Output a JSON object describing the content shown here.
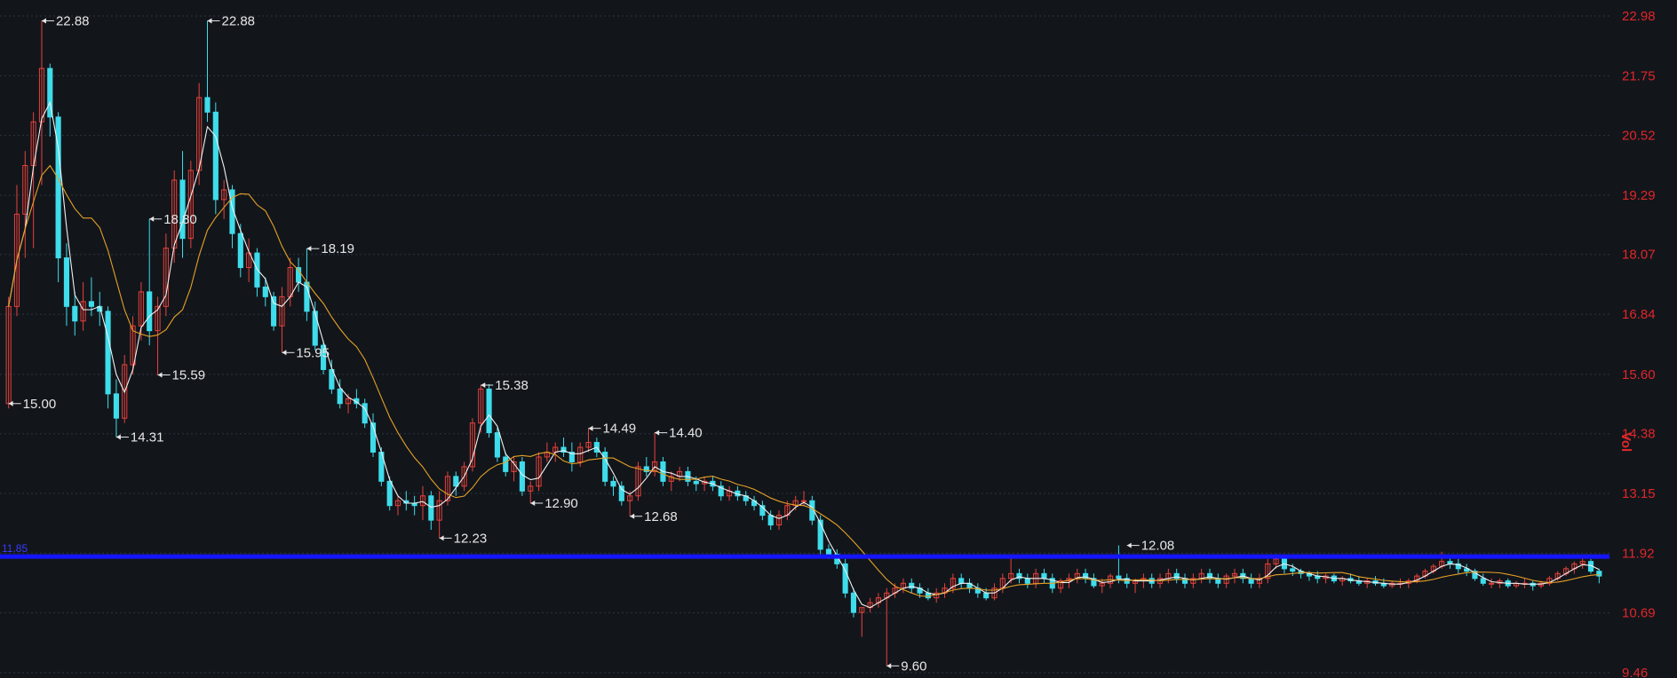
{
  "chart_data": {
    "type": "candlestick",
    "y_axis": {
      "ticks": [
        "22.98",
        "21.75",
        "20.52",
        "19.29",
        "18.07",
        "16.84",
        "15.60",
        "14.38",
        "13.15",
        "11.92",
        "10.69",
        "9.46"
      ],
      "ylim": [
        9.46,
        22.98
      ],
      "unit_label": "Vol"
    },
    "grid": true,
    "horizontal_line": {
      "value": 11.85,
      "label": "11.85",
      "color": "#1515ff"
    },
    "annotations": [
      {
        "label": "22.88",
        "value": 22.88,
        "bar": 4
      },
      {
        "label": "22.88",
        "value": 22.88,
        "bar": 24
      },
      {
        "label": "18.80",
        "value": 18.8,
        "bar": 17
      },
      {
        "label": "18.19",
        "value": 18.19,
        "bar": 36
      },
      {
        "label": "15.95",
        "value": 16.05,
        "bar": 33
      },
      {
        "label": "15.59",
        "value": 15.59,
        "bar": 18
      },
      {
        "label": "15.00",
        "value": 15.0,
        "bar": 0
      },
      {
        "label": "14.31",
        "value": 14.31,
        "bar": 13
      },
      {
        "label": "15.38",
        "value": 15.38,
        "bar": 57
      },
      {
        "label": "14.49",
        "value": 14.49,
        "bar": 70
      },
      {
        "label": "14.40",
        "value": 14.4,
        "bar": 78
      },
      {
        "label": "12.90",
        "value": 12.95,
        "bar": 63
      },
      {
        "label": "12.68",
        "value": 12.68,
        "bar": 75
      },
      {
        "label": "12.23",
        "value": 12.23,
        "bar": 52
      },
      {
        "label": "12.08",
        "value": 12.08,
        "bar": 135
      },
      {
        "label": "9.60",
        "value": 9.6,
        "bar": 106
      }
    ],
    "candles": [
      [
        15.0,
        17.2,
        14.9,
        17.0
      ],
      [
        17.0,
        19.5,
        16.8,
        18.9
      ],
      [
        18.9,
        20.2,
        18.0,
        19.9
      ],
      [
        19.9,
        21.0,
        18.2,
        20.8
      ],
      [
        20.8,
        22.88,
        19.5,
        21.9
      ],
      [
        21.9,
        22.0,
        20.5,
        20.9
      ],
      [
        20.9,
        21.0,
        17.5,
        18.0
      ],
      [
        18.0,
        18.3,
        16.6,
        17.0
      ],
      [
        17.0,
        17.3,
        16.4,
        16.7
      ],
      [
        16.7,
        17.5,
        16.5,
        17.1
      ],
      [
        17.1,
        17.6,
        16.8,
        17.0
      ],
      [
        17.0,
        17.3,
        16.6,
        16.9
      ],
      [
        16.9,
        17.0,
        14.9,
        15.2
      ],
      [
        15.2,
        15.5,
        14.31,
        14.7
      ],
      [
        14.7,
        16.0,
        14.6,
        15.8
      ],
      [
        15.8,
        16.8,
        15.6,
        16.6
      ],
      [
        16.6,
        17.5,
        16.3,
        17.3
      ],
      [
        17.3,
        18.8,
        16.2,
        16.5
      ],
      [
        16.5,
        17.2,
        15.59,
        17.0
      ],
      [
        17.0,
        18.5,
        16.8,
        18.2
      ],
      [
        18.2,
        19.8,
        17.9,
        19.6
      ],
      [
        19.6,
        20.2,
        18.0,
        18.4
      ],
      [
        18.4,
        20.0,
        18.2,
        19.8
      ],
      [
        19.8,
        21.6,
        19.5,
        21.3
      ],
      [
        21.3,
        22.88,
        20.8,
        21.0
      ],
      [
        21.0,
        21.2,
        18.9,
        19.2
      ],
      [
        19.2,
        19.6,
        18.8,
        19.4
      ],
      [
        19.4,
        19.5,
        18.2,
        18.5
      ],
      [
        18.5,
        18.7,
        17.6,
        17.8
      ],
      [
        17.8,
        18.4,
        17.5,
        18.1
      ],
      [
        18.1,
        18.2,
        17.2,
        17.4
      ],
      [
        17.4,
        17.6,
        17.0,
        17.2
      ],
      [
        17.2,
        17.3,
        16.5,
        16.6
      ],
      [
        16.6,
        17.4,
        16.05,
        17.2
      ],
      [
        17.2,
        18.0,
        17.0,
        17.8
      ],
      [
        17.8,
        18.0,
        17.3,
        17.5
      ],
      [
        17.5,
        18.19,
        16.7,
        16.9
      ],
      [
        16.9,
        17.1,
        16.1,
        16.2
      ],
      [
        16.2,
        16.3,
        15.6,
        15.7
      ],
      [
        15.7,
        15.9,
        15.2,
        15.3
      ],
      [
        15.3,
        15.5,
        14.9,
        15.0
      ],
      [
        15.0,
        15.2,
        14.8,
        15.1
      ],
      [
        15.1,
        15.3,
        14.9,
        15.0
      ],
      [
        15.0,
        15.1,
        14.5,
        14.6
      ],
      [
        14.6,
        14.8,
        13.9,
        14.0
      ],
      [
        14.0,
        14.1,
        13.3,
        13.4
      ],
      [
        13.4,
        13.5,
        12.8,
        12.9
      ],
      [
        12.9,
        13.1,
        12.7,
        13.0
      ],
      [
        13.0,
        13.2,
        12.8,
        12.95
      ],
      [
        12.95,
        13.1,
        12.7,
        12.9
      ],
      [
        12.9,
        13.3,
        12.6,
        13.1
      ],
      [
        13.1,
        13.2,
        12.4,
        12.6
      ],
      [
        12.6,
        13.2,
        12.23,
        13.0
      ],
      [
        13.0,
        13.6,
        12.9,
        13.5
      ],
      [
        13.5,
        13.6,
        13.1,
        13.3
      ],
      [
        13.3,
        13.8,
        13.2,
        13.7
      ],
      [
        13.7,
        14.7,
        13.6,
        14.6
      ],
      [
        14.6,
        15.38,
        14.4,
        15.3
      ],
      [
        15.3,
        15.4,
        14.3,
        14.4
      ],
      [
        14.4,
        14.5,
        13.8,
        13.9
      ],
      [
        13.9,
        14.0,
        13.5,
        13.6
      ],
      [
        13.6,
        13.9,
        13.4,
        13.8
      ],
      [
        13.8,
        13.9,
        13.1,
        13.2
      ],
      [
        13.2,
        13.4,
        12.95,
        13.3
      ],
      [
        13.3,
        14.0,
        13.2,
        13.9
      ],
      [
        13.9,
        14.2,
        13.8,
        14.0
      ],
      [
        14.0,
        14.2,
        13.8,
        14.1
      ],
      [
        14.1,
        14.3,
        13.9,
        14.0
      ],
      [
        14.0,
        14.2,
        13.6,
        13.8
      ],
      [
        13.8,
        14.2,
        13.7,
        14.1
      ],
      [
        14.1,
        14.49,
        14.0,
        14.2
      ],
      [
        14.2,
        14.3,
        13.9,
        14.0
      ],
      [
        14.0,
        14.1,
        13.3,
        13.4
      ],
      [
        13.4,
        13.5,
        13.1,
        13.3
      ],
      [
        13.3,
        13.4,
        12.9,
        13.0
      ],
      [
        13.0,
        13.2,
        12.68,
        13.1
      ],
      [
        13.1,
        13.8,
        13.0,
        13.7
      ],
      [
        13.7,
        13.9,
        13.5,
        13.6
      ],
      [
        13.6,
        14.4,
        13.5,
        13.8
      ],
      [
        13.8,
        13.9,
        13.3,
        13.4
      ],
      [
        13.4,
        13.6,
        13.2,
        13.5
      ],
      [
        13.5,
        13.7,
        13.4,
        13.6
      ],
      [
        13.6,
        13.7,
        13.3,
        13.4
      ],
      [
        13.4,
        13.5,
        13.2,
        13.35
      ],
      [
        13.35,
        13.5,
        13.2,
        13.4
      ],
      [
        13.4,
        13.5,
        13.2,
        13.3
      ],
      [
        13.3,
        13.4,
        13.0,
        13.1
      ],
      [
        13.1,
        13.3,
        13.0,
        13.2
      ],
      [
        13.2,
        13.3,
        13.0,
        13.1
      ],
      [
        13.1,
        13.2,
        12.9,
        13.0
      ],
      [
        13.0,
        13.1,
        12.8,
        12.9
      ],
      [
        12.9,
        13.0,
        12.6,
        12.7
      ],
      [
        12.7,
        12.8,
        12.4,
        12.5
      ],
      [
        12.5,
        12.8,
        12.4,
        12.7
      ],
      [
        12.7,
        13.0,
        12.6,
        12.9
      ],
      [
        12.9,
        13.1,
        12.8,
        13.0
      ],
      [
        13.0,
        13.2,
        12.9,
        13.0
      ],
      [
        13.0,
        13.1,
        12.5,
        12.6
      ],
      [
        12.6,
        12.7,
        11.9,
        12.0
      ],
      [
        12.0,
        12.1,
        11.8,
        11.9
      ],
      [
        11.9,
        12.0,
        11.6,
        11.7
      ],
      [
        11.7,
        11.8,
        11.0,
        11.1
      ],
      [
        11.1,
        11.2,
        10.6,
        10.7
      ],
      [
        10.7,
        10.8,
        10.2,
        10.8
      ],
      [
        10.8,
        11.0,
        10.7,
        10.9
      ],
      [
        10.9,
        11.1,
        10.8,
        11.0
      ],
      [
        11.0,
        11.2,
        9.6,
        11.1
      ],
      [
        11.1,
        11.3,
        11.0,
        11.2
      ],
      [
        11.2,
        11.4,
        11.1,
        11.3
      ],
      [
        11.3,
        11.4,
        11.1,
        11.2
      ],
      [
        11.2,
        11.3,
        11.0,
        11.1
      ],
      [
        11.1,
        11.2,
        10.95,
        11.0
      ],
      [
        11.0,
        11.2,
        10.9,
        11.1
      ],
      [
        11.1,
        11.3,
        11.0,
        11.2
      ],
      [
        11.2,
        11.5,
        11.1,
        11.4
      ],
      [
        11.4,
        11.5,
        11.2,
        11.3
      ],
      [
        11.3,
        11.4,
        11.1,
        11.2
      ],
      [
        11.2,
        11.3,
        11.0,
        11.1
      ],
      [
        11.1,
        11.2,
        10.95,
        11.0
      ],
      [
        11.0,
        11.3,
        10.95,
        11.2
      ],
      [
        11.2,
        11.5,
        11.1,
        11.4
      ],
      [
        11.4,
        11.9,
        11.3,
        11.5
      ],
      [
        11.5,
        11.6,
        11.3,
        11.4
      ],
      [
        11.4,
        11.5,
        11.2,
        11.3
      ],
      [
        11.3,
        11.6,
        11.2,
        11.5
      ],
      [
        11.5,
        11.6,
        11.3,
        11.4
      ],
      [
        11.4,
        11.5,
        11.1,
        11.2
      ],
      [
        11.2,
        11.4,
        11.1,
        11.35
      ],
      [
        11.35,
        11.5,
        11.2,
        11.4
      ],
      [
        11.4,
        11.6,
        11.3,
        11.5
      ],
      [
        11.5,
        11.6,
        11.3,
        11.4
      ],
      [
        11.4,
        11.5,
        11.2,
        11.25
      ],
      [
        11.25,
        11.4,
        11.1,
        11.3
      ],
      [
        11.3,
        11.5,
        11.2,
        11.45
      ],
      [
        11.45,
        12.08,
        11.3,
        11.4
      ],
      [
        11.4,
        11.5,
        11.2,
        11.3
      ],
      [
        11.3,
        11.4,
        11.1,
        11.35
      ],
      [
        11.35,
        11.5,
        11.2,
        11.4
      ],
      [
        11.4,
        11.5,
        11.2,
        11.3
      ],
      [
        11.3,
        11.5,
        11.2,
        11.4
      ],
      [
        11.4,
        11.6,
        11.3,
        11.5
      ],
      [
        11.5,
        11.6,
        11.3,
        11.4
      ],
      [
        11.4,
        11.5,
        11.2,
        11.3
      ],
      [
        11.3,
        11.5,
        11.2,
        11.4
      ],
      [
        11.4,
        11.6,
        11.3,
        11.5
      ],
      [
        11.5,
        11.6,
        11.3,
        11.4
      ],
      [
        11.4,
        11.5,
        11.2,
        11.3
      ],
      [
        11.3,
        11.5,
        11.2,
        11.45
      ],
      [
        11.45,
        11.6,
        11.3,
        11.5
      ],
      [
        11.5,
        11.6,
        11.3,
        11.4
      ],
      [
        11.4,
        11.5,
        11.2,
        11.3
      ],
      [
        11.3,
        11.5,
        11.2,
        11.4
      ],
      [
        11.4,
        11.8,
        11.3,
        11.7
      ],
      [
        11.7,
        11.9,
        11.6,
        11.8
      ],
      [
        11.8,
        11.85,
        11.5,
        11.6
      ],
      [
        11.6,
        11.7,
        11.45,
        11.55
      ],
      [
        11.55,
        11.6,
        11.4,
        11.5
      ],
      [
        11.5,
        11.55,
        11.35,
        11.45
      ],
      [
        11.45,
        11.55,
        11.3,
        11.4
      ],
      [
        11.4,
        11.5,
        11.3,
        11.45
      ],
      [
        11.45,
        11.5,
        11.3,
        11.35
      ],
      [
        11.35,
        11.45,
        11.25,
        11.4
      ],
      [
        11.4,
        11.5,
        11.3,
        11.35
      ],
      [
        11.35,
        11.45,
        11.25,
        11.3
      ],
      [
        11.3,
        11.4,
        11.2,
        11.35
      ],
      [
        11.35,
        11.45,
        11.25,
        11.3
      ],
      [
        11.3,
        11.4,
        11.2,
        11.25
      ],
      [
        11.25,
        11.35,
        11.2,
        11.3
      ],
      [
        11.3,
        11.4,
        11.2,
        11.3
      ],
      [
        11.3,
        11.4,
        11.2,
        11.35
      ],
      [
        11.35,
        11.5,
        11.3,
        11.45
      ],
      [
        11.45,
        11.6,
        11.4,
        11.55
      ],
      [
        11.55,
        11.7,
        11.5,
        11.65
      ],
      [
        11.65,
        11.95,
        11.6,
        11.75
      ],
      [
        11.75,
        11.85,
        11.6,
        11.7
      ],
      [
        11.7,
        11.8,
        11.5,
        11.6
      ],
      [
        11.6,
        11.7,
        11.45,
        11.55
      ],
      [
        11.55,
        11.6,
        11.35,
        11.4
      ],
      [
        11.4,
        11.5,
        11.25,
        11.3
      ],
      [
        11.3,
        11.4,
        11.2,
        11.3
      ],
      [
        11.3,
        11.4,
        11.2,
        11.35
      ],
      [
        11.35,
        11.4,
        11.2,
        11.25
      ],
      [
        11.25,
        11.35,
        11.2,
        11.3
      ],
      [
        11.3,
        11.4,
        11.2,
        11.3
      ],
      [
        11.3,
        11.35,
        11.15,
        11.25
      ],
      [
        11.25,
        11.35,
        11.2,
        11.3
      ],
      [
        11.3,
        11.45,
        11.25,
        11.4
      ],
      [
        11.4,
        11.55,
        11.35,
        11.5
      ],
      [
        11.5,
        11.65,
        11.45,
        11.6
      ],
      [
        11.6,
        11.75,
        11.5,
        11.7
      ],
      [
        11.7,
        11.85,
        11.6,
        11.75
      ],
      [
        11.75,
        11.8,
        11.5,
        11.55
      ],
      [
        11.55,
        11.6,
        11.3,
        11.45
      ]
    ],
    "colors": {
      "up": "#e8413b",
      "down": "#3fdceb",
      "ma_short": "#f0f0f0",
      "ma_long": "#e6a025",
      "tick": "#e0262a",
      "grid": "#2c3440"
    }
  }
}
